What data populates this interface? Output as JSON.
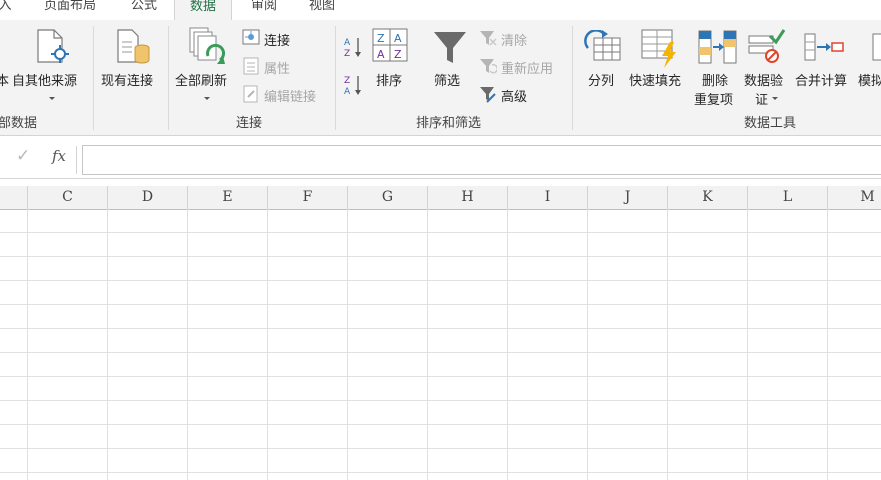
{
  "tabs": [
    "入",
    "页面布局",
    "公式",
    "数据",
    "审阅",
    "视图"
  ],
  "active_tab": "数据",
  "ribbon": {
    "get_external": {
      "partial_label": "本",
      "from_other_sources": "自其他来源",
      "existing_connections": "现有连接",
      "group_label": "部数据"
    },
    "connections": {
      "refresh_all": "全部刷新",
      "connections": "连接",
      "properties": "属性",
      "edit_links": "编辑链接",
      "group_label": "连接"
    },
    "sort_filter": {
      "sort": "排序",
      "filter": "筛选",
      "clear": "清除",
      "reapply": "重新应用",
      "advanced": "高级",
      "group_label": "排序和筛选"
    },
    "data_tools": {
      "text_to_columns": "分列",
      "flash_fill": "快速填充",
      "remove_dup_1": "删除",
      "remove_dup_2": "重复项",
      "data_validation_1": "数据验",
      "data_validation_2": "证",
      "consolidate": "合并计算",
      "what_if_partial": "模拟",
      "group_label": "数据工具"
    }
  },
  "formula_bar": {
    "enter_symbol": "✓",
    "fx_symbol": "fx",
    "value": ""
  },
  "columns": [
    "C",
    "D",
    "E",
    "F",
    "G",
    "H",
    "I",
    "J",
    "K",
    "L",
    "M"
  ],
  "colors": {
    "accent": "#217346",
    "ribbon_bg": "#f3f3f3",
    "grid_line": "#e0e0e0"
  }
}
